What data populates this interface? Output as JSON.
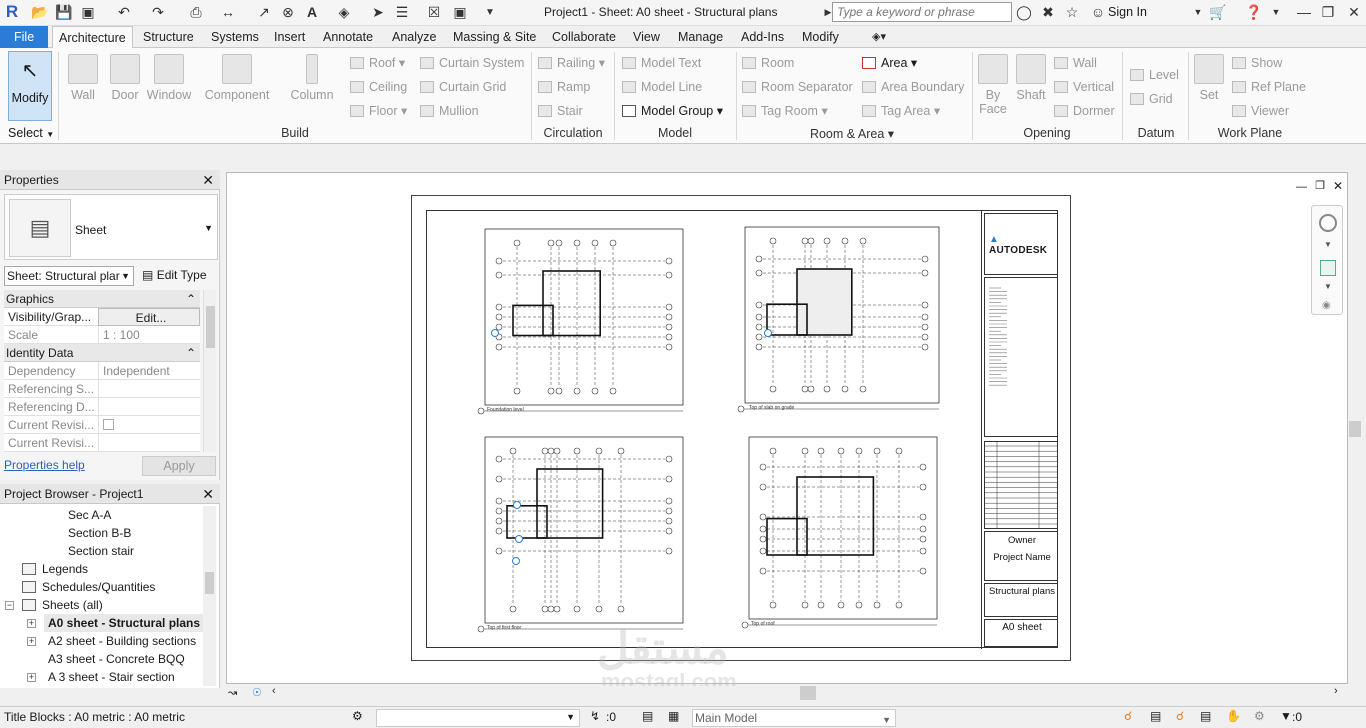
{
  "window": {
    "title": "Project1 - Sheet: A0 sheet - Structural plans",
    "search_placeholder": "Type a keyword or phrase",
    "sign_in": "Sign In"
  },
  "tabs": [
    "File",
    "Architecture",
    "Structure",
    "Systems",
    "Insert",
    "Annotate",
    "Analyze",
    "Massing & Site",
    "Collaborate",
    "View",
    "Manage",
    "Add-Ins",
    "Modify"
  ],
  "active_tab": "Architecture",
  "ribbon": {
    "modify": "Modify",
    "select_label": "Select",
    "build": {
      "label": "Build",
      "wall": "Wall",
      "door": "Door",
      "window": "Window",
      "component": "Component",
      "column": "Column",
      "roof": "Roof",
      "ceiling": "Ceiling",
      "floor": "Floor",
      "curtain_system": "Curtain System",
      "curtain_grid": "Curtain Grid",
      "mullion": "Mullion"
    },
    "circulation": {
      "label": "Circulation",
      "railing": "Railing",
      "ramp": "Ramp",
      "stair": "Stair"
    },
    "model": {
      "label": "Model",
      "model_text": "Model Text",
      "model_line": "Model Line",
      "model_group": "Model Group"
    },
    "room_area": {
      "label": "Room & Area",
      "room": "Room",
      "room_separator": "Room Separator",
      "tag_room": "Tag Room",
      "area": "Area",
      "area_boundary": "Area Boundary",
      "tag_area": "Tag Area"
    },
    "opening": {
      "label": "Opening",
      "by_face": "By Face",
      "shaft": "Shaft",
      "wall": "Wall",
      "vertical": "Vertical",
      "dormer": "Dormer"
    },
    "datum": {
      "label": "Datum",
      "level": "Level",
      "grid": "Grid"
    },
    "work_plane": {
      "label": "Work Plane",
      "set": "Set",
      "show": "Show",
      "ref_plane": "Ref Plane",
      "viewer": "Viewer"
    }
  },
  "properties": {
    "title": "Properties",
    "type_name": "Sheet",
    "instance_selector": "Sheet: Structural plar",
    "edit_type": "Edit Type",
    "groups": [
      {
        "name": "Graphics"
      },
      {
        "name": "Identity Data"
      }
    ],
    "rows": {
      "visibility": {
        "key": "Visibility/Grap...",
        "value": "Edit..."
      },
      "scale": {
        "key": "Scale",
        "value": "1 : 100"
      },
      "dependency": {
        "key": "Dependency",
        "value": "Independent"
      },
      "ref_sheet": {
        "key": "Referencing S...",
        "value": ""
      },
      "ref_detail": {
        "key": "Referencing D...",
        "value": ""
      },
      "current_rev1": {
        "key": "Current Revisi...",
        "value": ""
      },
      "current_rev2": {
        "key": "Current Revisi...",
        "value": ""
      }
    },
    "help": "Properties help",
    "apply": "Apply"
  },
  "browser": {
    "title": "Project Browser - Project1",
    "items": [
      {
        "label": "Sec A-A"
      },
      {
        "label": "Section B-B"
      },
      {
        "label": "Section stair"
      },
      {
        "label": "Legends"
      },
      {
        "label": "Schedules/Quantities"
      },
      {
        "label": "Sheets (all)"
      },
      {
        "label": "A0 sheet - Structural plans"
      },
      {
        "label": "A2 sheet - Building sections"
      },
      {
        "label": "A3 sheet - Concrete BQQ"
      },
      {
        "label": "A 3 sheet - Stair section"
      }
    ]
  },
  "sheet": {
    "plans": [
      {
        "label": "Foundation level"
      },
      {
        "label": "Top of slab on grade"
      },
      {
        "label": "Top of first floor"
      },
      {
        "label": "Top of roof"
      }
    ],
    "titleblock": {
      "brand": "AUTODESK",
      "owner": "Owner",
      "project_name": "Project Name",
      "sheet_title": "Structural plans",
      "sheet_number": "A0 sheet"
    }
  },
  "watermark": {
    "arabic": "مستقل",
    "latin": "mostaql.com"
  },
  "statusbar": {
    "left": "Title Blocks : A0 metric : A0 metric",
    "zero1": ":0",
    "workset": "Main Model",
    "zero2": ":0"
  }
}
